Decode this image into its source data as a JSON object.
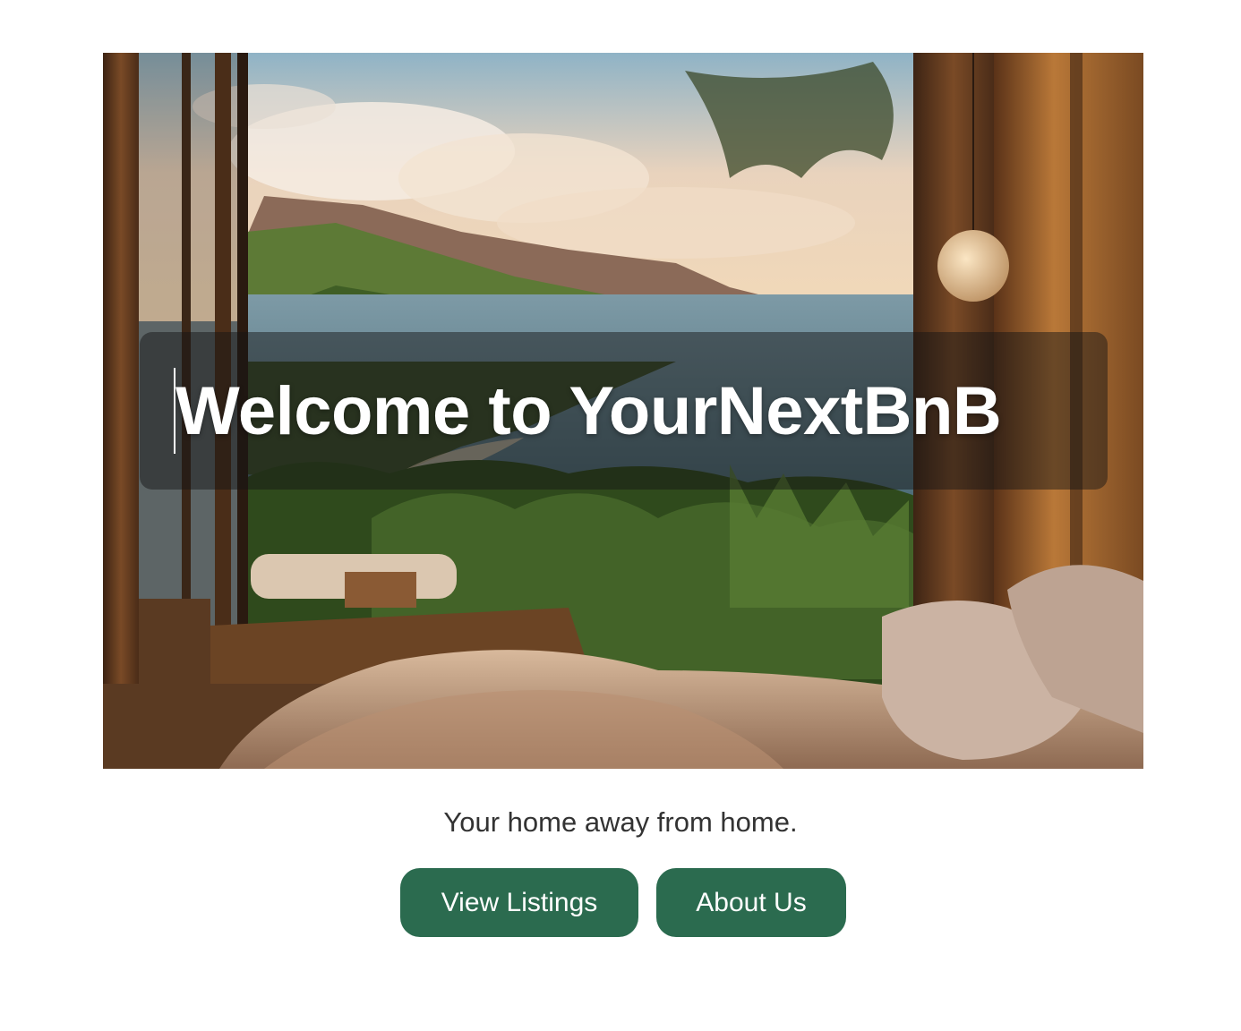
{
  "hero": {
    "image_alt": "Bedroom with a window view over a tropical coastline",
    "title": "Welcome to YourNextBnB"
  },
  "tagline": "Your home away from home.",
  "buttons": {
    "listings_label": "View Listings",
    "about_label": "About Us"
  },
  "colors": {
    "button_bg": "#2b6b4f",
    "button_text": "#ffffff",
    "tagline_text": "#333333",
    "title_text": "#ffffff",
    "page_bg": "#ffffff"
  }
}
